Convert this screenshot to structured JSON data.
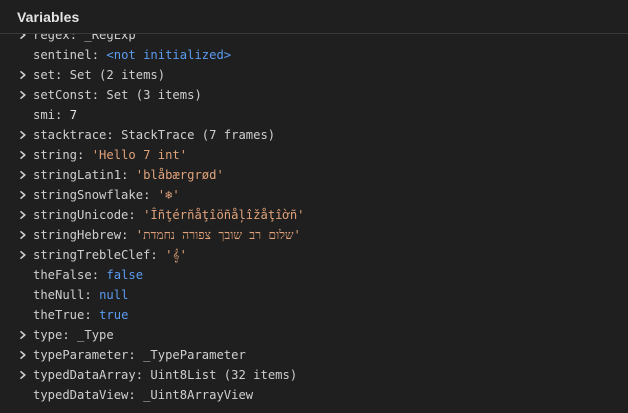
{
  "panel": {
    "title": "Variables"
  },
  "rows": [
    {
      "name": "regex",
      "value": "_RegExp",
      "kind": "obj",
      "expandable": true
    },
    {
      "name": "sentinel",
      "value": "<not initialized>",
      "kind": "kw",
      "expandable": false
    },
    {
      "name": "set",
      "value": "Set (2 items)",
      "kind": "obj",
      "expandable": true
    },
    {
      "name": "setConst",
      "value": "Set (3 items)",
      "kind": "obj",
      "expandable": true
    },
    {
      "name": "smi",
      "value": "7",
      "kind": "num",
      "expandable": false
    },
    {
      "name": "stacktrace",
      "value": "StackTrace (7 frames)",
      "kind": "obj",
      "expandable": true
    },
    {
      "name": "string",
      "value": "'Hello 7 int'",
      "kind": "str",
      "expandable": true
    },
    {
      "name": "stringLatin1",
      "value": "'blåbærgrød'",
      "kind": "str",
      "expandable": true
    },
    {
      "name": "stringSnowflake",
      "value": "'❄'",
      "kind": "str",
      "expandable": true
    },
    {
      "name": "stringUnicode",
      "value": "'Îñţérñåţîöñåļîžåţîờñ'",
      "kind": "str",
      "expandable": true
    },
    {
      "name": "stringHebrew",
      "value": "'שלום רב שובך צפורה נחמדת'",
      "kind": "str",
      "expandable": true
    },
    {
      "name": "stringTrebleClef",
      "value": "'𝄞'",
      "kind": "str",
      "expandable": true
    },
    {
      "name": "theFalse",
      "value": "false",
      "kind": "kw",
      "expandable": false
    },
    {
      "name": "theNull",
      "value": "null",
      "kind": "kw",
      "expandable": false
    },
    {
      "name": "theTrue",
      "value": "true",
      "kind": "kw",
      "expandable": false
    },
    {
      "name": "type",
      "value": "_Type",
      "kind": "obj",
      "expandable": true
    },
    {
      "name": "typeParameter",
      "value": "_TypeParameter",
      "kind": "obj",
      "expandable": true
    },
    {
      "name": "typedDataArray",
      "value": "Uint8List (32 items)",
      "kind": "obj",
      "expandable": true
    },
    {
      "name": "typedDataView",
      "value": "_Uint8ArrayView",
      "kind": "obj",
      "expandable": false
    }
  ],
  "colors": {
    "background": "#1f1f1f",
    "name": "#cfcfcf",
    "string": "#e0a27a",
    "keyword": "#5b9bf0",
    "number": "#e8e8e8"
  },
  "icons": {
    "expand": "chevron-right-icon"
  }
}
